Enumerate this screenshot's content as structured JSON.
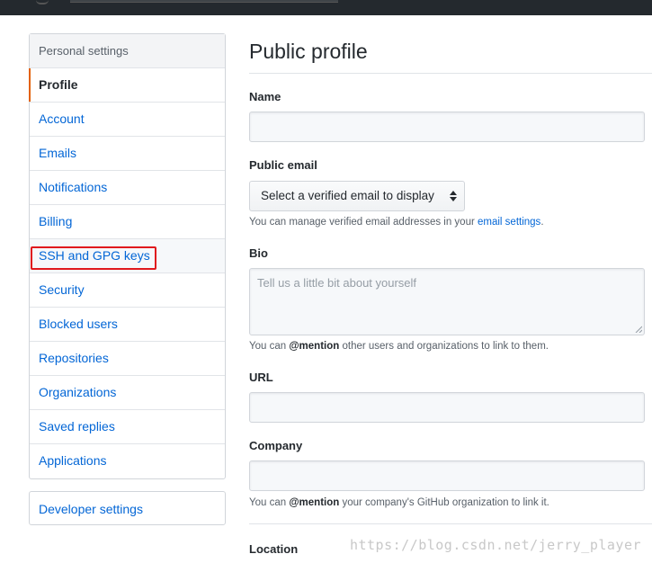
{
  "sidebar": {
    "heading": "Personal settings",
    "items": [
      {
        "label": "Profile"
      },
      {
        "label": "Account"
      },
      {
        "label": "Emails"
      },
      {
        "label": "Notifications"
      },
      {
        "label": "Billing"
      },
      {
        "label": "SSH and GPG keys"
      },
      {
        "label": "Security"
      },
      {
        "label": "Blocked users"
      },
      {
        "label": "Repositories"
      },
      {
        "label": "Organizations"
      },
      {
        "label": "Saved replies"
      },
      {
        "label": "Applications"
      }
    ],
    "developer_settings": "Developer settings"
  },
  "main": {
    "title": "Public profile",
    "name": {
      "label": "Name",
      "value": ""
    },
    "public_email": {
      "label": "Public email",
      "selected": "Select a verified email to display",
      "note_prefix": "You can manage verified email addresses in your ",
      "note_link": "email settings",
      "note_suffix": "."
    },
    "bio": {
      "label": "Bio",
      "placeholder": "Tell us a little bit about yourself",
      "note_prefix": "You can ",
      "note_mention": "@mention",
      "note_suffix": " other users and organizations to link to them."
    },
    "url": {
      "label": "URL",
      "value": ""
    },
    "company": {
      "label": "Company",
      "value": "",
      "note_prefix": "You can ",
      "note_mention": "@mention",
      "note_suffix": " your company's GitHub organization to link it."
    },
    "location": {
      "label": "Location"
    }
  },
  "watermark": "https://blog.csdn.net/jerry_player",
  "colors": {
    "link": "#0366d6",
    "selected_bar": "#e36209",
    "highlight_box": "#e0191d",
    "topbar": "#24292e"
  }
}
